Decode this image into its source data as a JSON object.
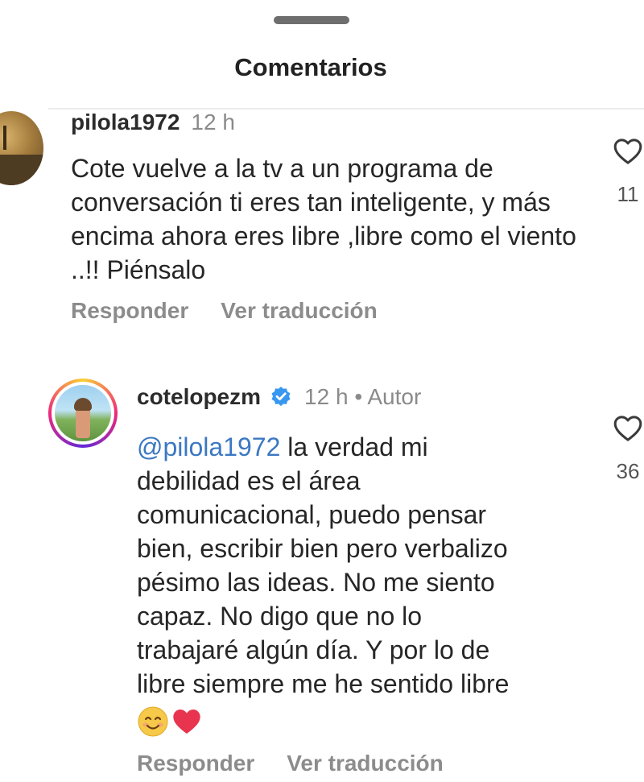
{
  "sheet": {
    "title": "Comentarios"
  },
  "comments": [
    {
      "username": "pilola1972",
      "time": "12 h",
      "text": "Cote vuelve a la tv a un programa de conversación ti eres tan inteligente, y más encima ahora eres libre ,libre como el viento ..!! Piénsalo",
      "like_count": "11",
      "reply_label": "Responder",
      "translate_label": "Ver traducción"
    },
    {
      "username": "cotelopezm",
      "verified": true,
      "time": "12 h",
      "separator": "•",
      "author_label": "Autor",
      "mention": "@pilola1972",
      "text_lines": [
        " la verdad mi",
        "debilidad es el área",
        "comunicacional, puedo pensar",
        "bien, escribir bien pero verbalizo",
        "pésimo las ideas. No me siento",
        "capaz. No digo que no lo",
        "trabajaré algún día. Y por lo de",
        "libre siempre me he sentido libre"
      ],
      "emojis": [
        "smiling-face-emoji",
        "red-heart-emoji"
      ],
      "like_count": "36",
      "reply_label": "Responder",
      "translate_label": "Ver traducción"
    }
  ],
  "colors": {
    "mention": "#3b78c2",
    "verified_badge": "#3897f0",
    "muted_text": "#8a8a8a"
  }
}
